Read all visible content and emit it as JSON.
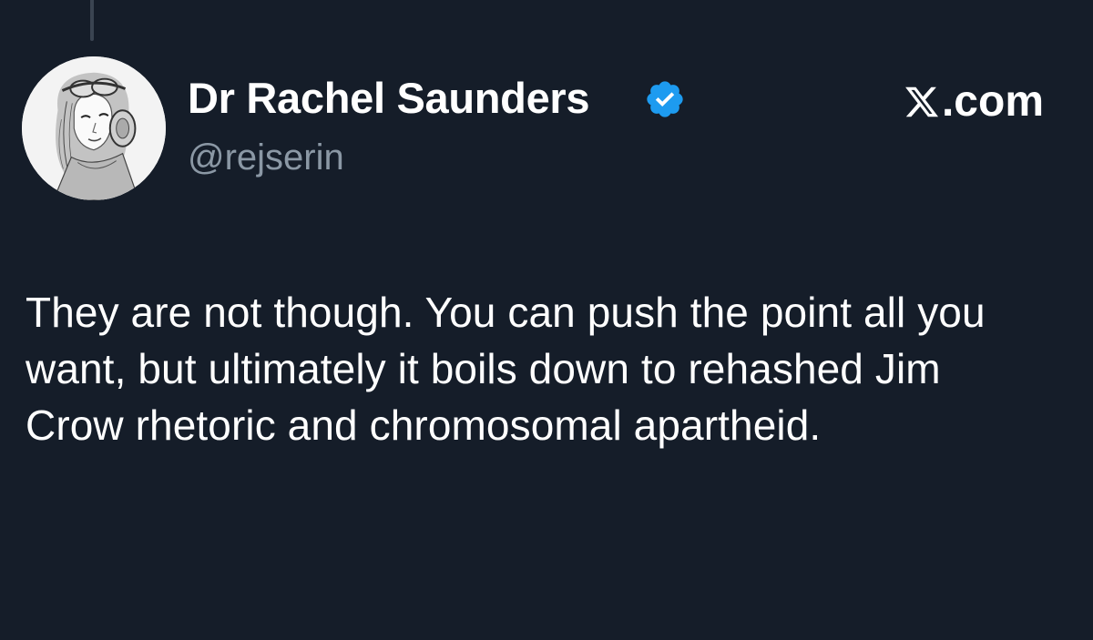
{
  "tweet": {
    "author_name": "Dr Rachel Saunders",
    "handle": "@rejserin",
    "verified": true,
    "verified_color": "#1d9bf0",
    "avatar_icon": "avatar-illustration",
    "text": "They are not though. You can push the point all you want, but ultimately it boils down to rehashed Jim Crow rhetoric and chromosomal apartheid."
  },
  "branding": {
    "logo_icon": "x-logo-icon",
    "logo_text": ".com"
  },
  "colors": {
    "background": "#151d29",
    "text_primary": "#ffffff",
    "text_secondary": "#8b98a5",
    "thread_line": "#3a4451"
  }
}
